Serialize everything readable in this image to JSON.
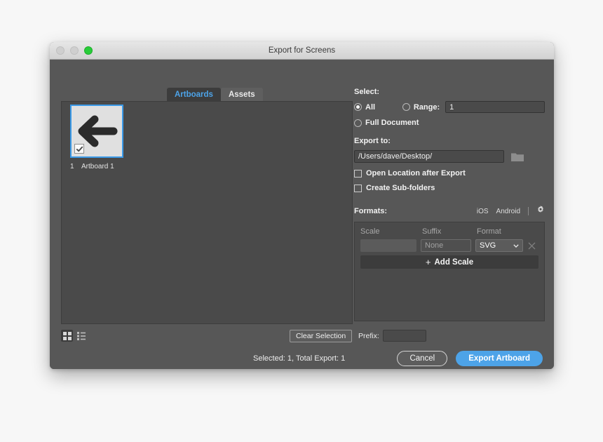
{
  "window": {
    "title": "Export for Screens",
    "traffic_lights": [
      "close-inactive",
      "minimize-inactive",
      "maximize-active"
    ],
    "accent_blue": "#4da3e8",
    "panel_bg": "#4a4a4a",
    "window_bg": "#575757"
  },
  "tabs": [
    {
      "label": "Artboards",
      "active": true
    },
    {
      "label": "Assets",
      "active": false
    }
  ],
  "artboards": [
    {
      "index": "1",
      "label": "Artboard 1",
      "selected": true,
      "checked": true,
      "icon": "left-arrow-graphic"
    }
  ],
  "view_modes": [
    {
      "name": "grid-view",
      "active": true
    },
    {
      "name": "list-view",
      "active": false
    }
  ],
  "left_bar": {
    "clear_selection_label": "Clear Selection",
    "prefix_label": "Prefix:",
    "prefix_value": "",
    "prefix_placeholder": ""
  },
  "select_section": {
    "label": "Select:",
    "options": [
      {
        "label": "All",
        "selected": true
      },
      {
        "label": "Range:",
        "selected": false
      },
      {
        "label": "Full Document",
        "selected": false
      }
    ],
    "range_value": "1"
  },
  "export_to_section": {
    "label": "Export to:",
    "path_value": "/Users/dave/Desktop/",
    "folder_icon": "folder-icon",
    "checkboxes": [
      {
        "label": "Open Location after Export",
        "checked": false
      },
      {
        "label": "Create Sub-folders",
        "checked": false
      }
    ]
  },
  "formats_section": {
    "label": "Formats:",
    "presets": [
      {
        "label": "iOS"
      },
      {
        "label": "Android"
      }
    ],
    "settings_icon": "gear-icon",
    "columns": [
      "Scale",
      "Suffix",
      "Format"
    ],
    "rows": [
      {
        "scale_value": "",
        "suffix_value": "",
        "suffix_placeholder": "None",
        "format_value": "SVG",
        "delete_icon": "close-icon"
      }
    ],
    "add_scale_label": "Add Scale",
    "add_scale_plus": "+"
  },
  "footer": {
    "status": "Selected: 1, Total Export: 1",
    "cancel_label": "Cancel",
    "export_label": "Export Artboard"
  }
}
